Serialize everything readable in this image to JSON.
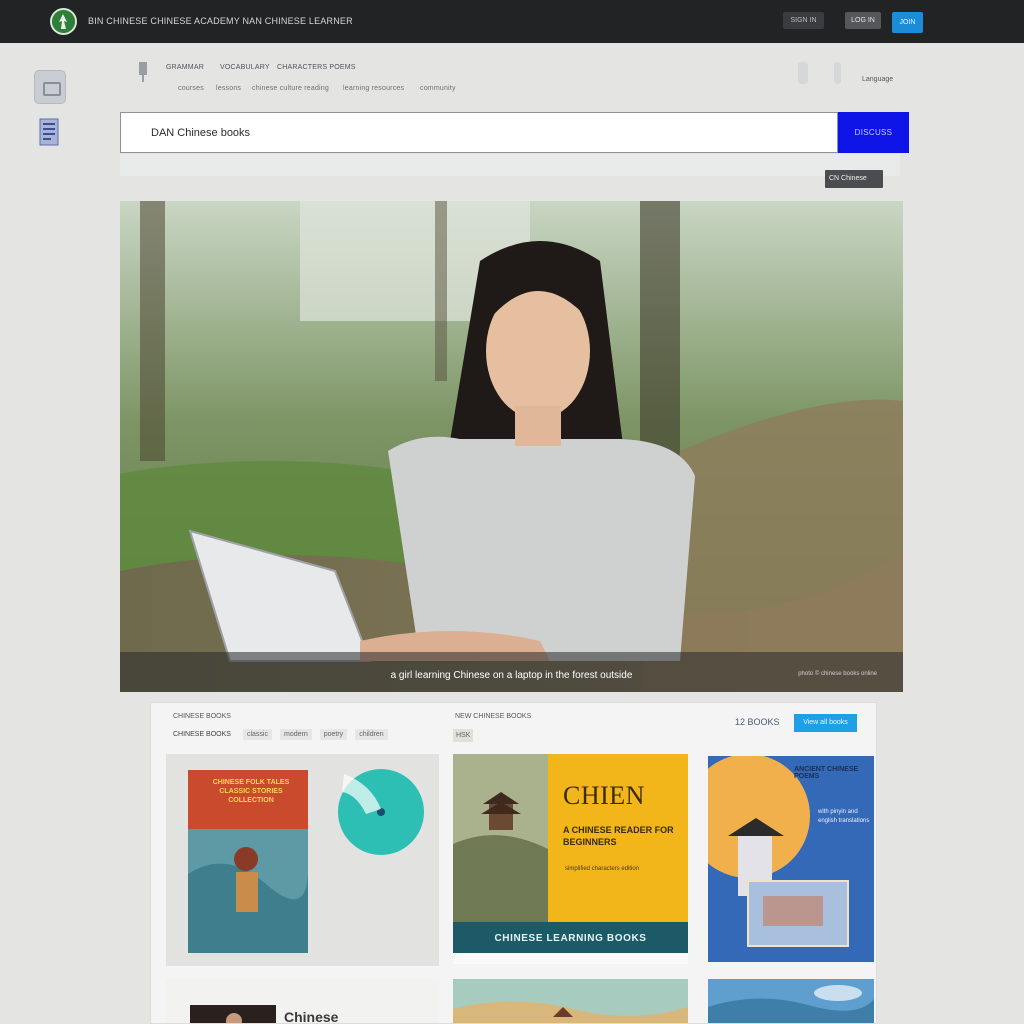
{
  "header": {
    "site_title": "BIN CHINESE CHINESE ACADEMY NAN CHINESE LEARNER",
    "buttons": [
      "SIGN IN",
      "LOG IN",
      "JOIN"
    ]
  },
  "nav": {
    "row1": [
      "GRAMMAR",
      "VOCABULARY",
      "CHARACTERS POEMS"
    ],
    "row2": [
      "courses",
      "lessons",
      "chinese culture reading",
      "learning resources",
      "community"
    ],
    "right_label": "Language"
  },
  "search": {
    "value": "DAN Chinese books",
    "button_label": "DISCUSS"
  },
  "lang_badge": "CN Chinese",
  "hero": {
    "caption": "a girl learning Chinese on a laptop in the forest outside",
    "credit": "photo © chinese books online"
  },
  "catalog": {
    "title": "CHINESE BOOKS",
    "subtitle": "NEW CHINESE BOOKS",
    "filters": [
      "CHINESE BOOKS",
      "classic",
      "modern",
      "poetry",
      "children"
    ],
    "filter_single": "HSK",
    "count": "12 BOOKS",
    "view_all": "View all books",
    "books": [
      {
        "title": "CHINESE FOLK TALES CLASSIC STORIES COLLECTION"
      },
      {
        "title": "CHIEN",
        "subtitle": "A CHINESE READER FOR BEGINNERS",
        "small": "simplified characters edition",
        "band": "CHINESE LEARNING BOOKS"
      },
      {
        "title": "ANCIENT CHINESE POEMS",
        "lines": "with pinyin and english translations"
      },
      {
        "title": "Chinese"
      }
    ]
  },
  "colors": {
    "topbar": "#222325",
    "accent_blue": "#0f14e6",
    "join_blue": "#1b8dd8"
  }
}
